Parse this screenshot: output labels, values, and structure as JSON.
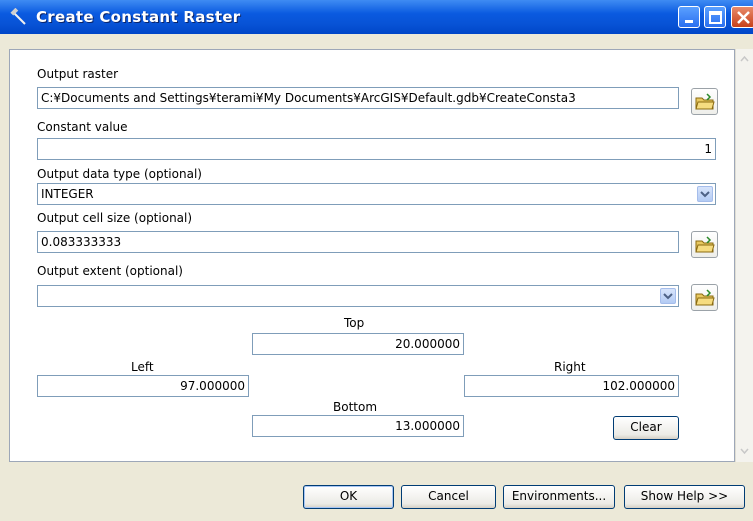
{
  "window": {
    "title": "Create Constant Raster"
  },
  "params": {
    "output_raster": {
      "label": "Output raster",
      "value": "C:¥Documents and Settings¥terami¥My Documents¥ArcGIS¥Default.gdb¥CreateConsta3"
    },
    "constant_value": {
      "label": "Constant value",
      "value": "1"
    },
    "data_type": {
      "label": "Output data type (optional)",
      "value": "INTEGER"
    },
    "cell_size": {
      "label": "Output cell size (optional)",
      "value": "0.083333333"
    },
    "extent": {
      "label": "Output extent (optional)",
      "value": "",
      "top_label": "Top",
      "top_value": "20.000000",
      "left_label": "Left",
      "left_value": "97.000000",
      "right_label": "Right",
      "right_value": "102.000000",
      "bottom_label": "Bottom",
      "bottom_value": "13.000000",
      "clear_label": "Clear"
    }
  },
  "buttons": {
    "ok": "OK",
    "cancel": "Cancel",
    "environments": "Environments...",
    "show_help": "Show Help >>"
  },
  "icons": {
    "title": "hammer-icon",
    "browse": "open-folder-icon",
    "combo": "chevron-down-icon"
  },
  "colors": {
    "titlebar": "#0a5ae0",
    "dialog_bg": "#ece9d8",
    "field_border": "#7f9db9"
  }
}
